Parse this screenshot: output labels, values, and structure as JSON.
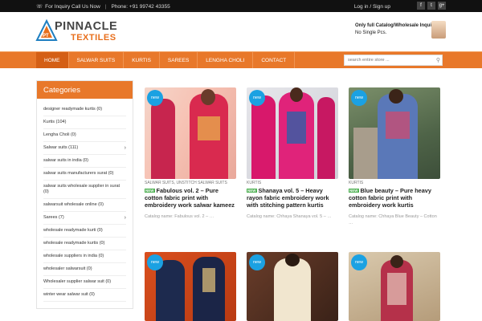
{
  "topbar": {
    "inquiry": "For Inquiry Call Us Now",
    "phone": "Phone: +91 99742 43355",
    "login": "Log in / Sign up",
    "social": [
      "f",
      "t",
      "g+"
    ]
  },
  "header": {
    "logo_mark": "PT",
    "logo_line1": "PINNACLE",
    "logo_line2": "TEXTILES",
    "promo_line1": "Only full Catalog/Wholesale Inquiry",
    "promo_line2": "No Single Pcs."
  },
  "nav": {
    "items": [
      "HOME",
      "SALWAR SUITS",
      "KURTIS",
      "SAREES",
      "LENGHA CHOLI",
      "CONTACT"
    ],
    "search_placeholder": "search entire store ..."
  },
  "sidebar": {
    "title": "Categories",
    "items": [
      "designer readymade kurtis (0)",
      "Kurtis (104)",
      "Lengha Choli (0)",
      "Salwar suits (111)",
      "salwar suits in india (0)",
      "salwar suits manufacturers surat (0)",
      "salwar suits wholesale supplier in surat (0)",
      "salwarsuit wholesale online (0)",
      "Sarees (7)",
      "wholesale readymade kurti (0)",
      "wholesale readymade kurtis (0)",
      "wholesale suppliers in india (0)",
      "wholesaler salwarsuit (0)",
      "Wholesaler supplier salwar suit (0)",
      "winter wear salwar suit (0)"
    ]
  },
  "products": [
    {
      "badge": "new",
      "tags": "SALWAR SUITS, UNSTITCH SALWAR SUITS",
      "new_tag": "NEW",
      "name": "Fabulous vol. 2 – Pure cotton fabric print with embroidery work salwar kameez",
      "catalog": "Catalog name:  Fabulous vol. 2 – …"
    },
    {
      "badge": "new",
      "tags": "KURTIS",
      "new_tag": "NEW",
      "name": "Shanaya vol. 5 – Heavy rayon fabric embroidery work with stitching pattern kurtis",
      "catalog": "Catalog name: Chhaya Shanaya vol. 5 – …"
    },
    {
      "badge": "new",
      "tags": "KURTIS",
      "new_tag": "NEW",
      "name": "Blue beauty – Pure heavy cotton fabric print with embroidery work kurtis",
      "catalog": "Catalog name: Chhaya Blue Beauty – Cotton …"
    },
    {
      "badge": "new"
    },
    {
      "badge": "new"
    },
    {
      "badge": "new"
    }
  ]
}
